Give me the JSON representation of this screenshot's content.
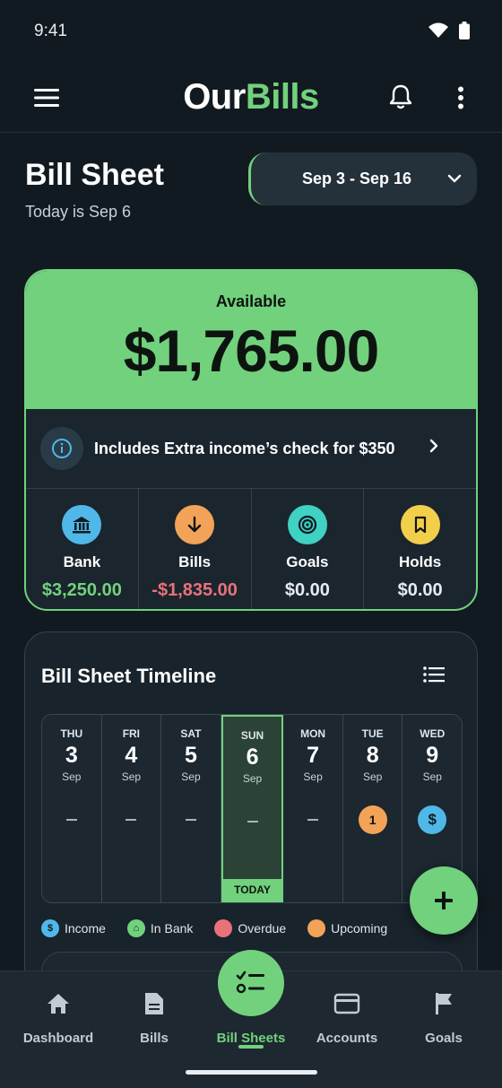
{
  "status_bar": {
    "time": "9:41"
  },
  "app_bar": {
    "logo_part1": "Our",
    "logo_part2": "Bills"
  },
  "page": {
    "title": "Bill Sheet",
    "today": "Today is Sep 6",
    "date_range": "Sep 3 - Sep 16"
  },
  "balance": {
    "available_label": "Available",
    "available_amount": "$1,765.00",
    "info_text": "Includes Extra income’s check for $350",
    "stats": [
      {
        "label": "Bank",
        "value": "$3,250.00",
        "icon": "bank-icon",
        "icon_color": "#4fb8e8",
        "value_color": "#72d17d"
      },
      {
        "label": "Bills",
        "value": "-$1,835.00",
        "icon": "arrow-down-icon",
        "icon_color": "#f2a357",
        "value_color": "#e8727a"
      },
      {
        "label": "Goals",
        "value": "$0.00",
        "icon": "target-icon",
        "icon_color": "#3fd1c1",
        "value_color": "#e6ebef"
      },
      {
        "label": "Holds",
        "value": "$0.00",
        "icon": "bookmark-icon",
        "icon_color": "#f2cf4a",
        "value_color": "#e6ebef"
      }
    ]
  },
  "timeline": {
    "title": "Bill Sheet Timeline",
    "today_tag": "TODAY",
    "days": [
      {
        "weekday": "THU",
        "day": "3",
        "month": "Sep"
      },
      {
        "weekday": "FRI",
        "day": "4",
        "month": "Sep"
      },
      {
        "weekday": "SAT",
        "day": "5",
        "month": "Sep"
      },
      {
        "weekday": "SUN",
        "day": "6",
        "month": "Sep"
      },
      {
        "weekday": "MON",
        "day": "7",
        "month": "Sep"
      },
      {
        "weekday": "TUE",
        "day": "8",
        "month": "Sep",
        "badge": "1"
      },
      {
        "weekday": "WED",
        "day": "9",
        "month": "Sep",
        "badge": "$"
      }
    ],
    "legend": [
      {
        "label": "Income",
        "color": "#4fb8e8",
        "glyph": "$"
      },
      {
        "label": "In Bank",
        "color": "#72d17d",
        "glyph": "⌂"
      },
      {
        "label": "Overdue",
        "color": "#e8727a",
        "glyph": ""
      },
      {
        "label": "Upcoming",
        "color": "#f2a357",
        "glyph": ""
      }
    ]
  },
  "nav": [
    {
      "label": "Dashboard"
    },
    {
      "label": "Bills"
    },
    {
      "label": "Bill Sheets"
    },
    {
      "label": "Accounts"
    },
    {
      "label": "Goals"
    }
  ],
  "colors": {
    "accent": "#72d17d",
    "background": "#121a21"
  }
}
